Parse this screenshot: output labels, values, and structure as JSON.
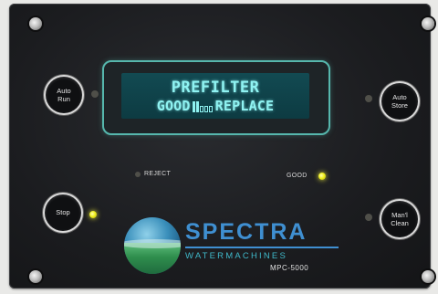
{
  "display": {
    "line1": "PREFILTER",
    "line2_left": "GOOD",
    "line2_right": "REPLACE",
    "meter_full_segments": 2,
    "meter_empty_segments": 3
  },
  "buttons": {
    "auto_run": "Auto Run",
    "auto_store": "Auto Store",
    "stop": "Stop",
    "manual_clean": "Man'l Clean"
  },
  "indicators": {
    "reject_label": "REJECT",
    "good_label": "GOOD"
  },
  "brand": {
    "name": "SPECTRA",
    "sub": "WATERMACHINES",
    "model": "MPC-5000"
  },
  "colors": {
    "lcd_text": "#8ff3f2",
    "bezel": "#56b7ad",
    "led_on": "#f1f01d",
    "brand_blue": "#3f8fd1"
  }
}
